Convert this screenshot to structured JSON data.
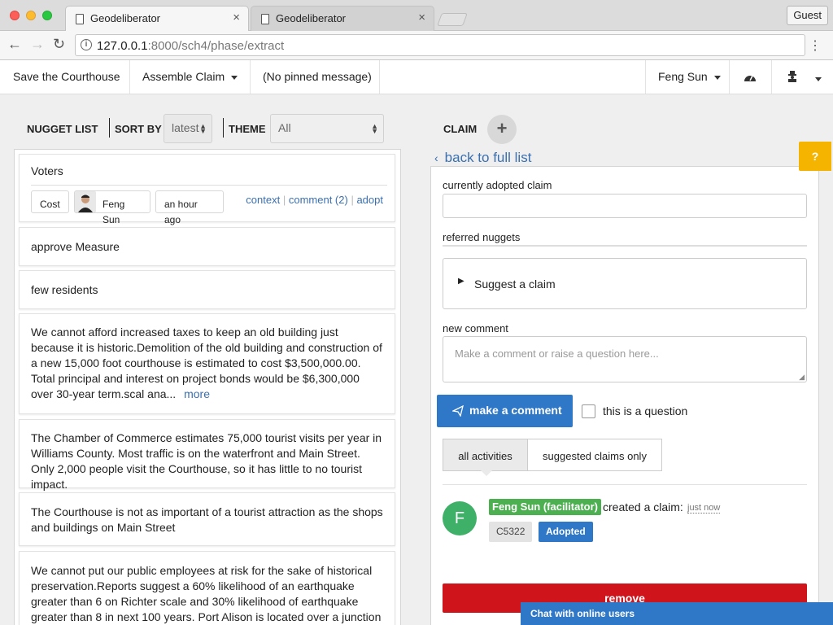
{
  "browser": {
    "tabs": [
      {
        "title": "Geodeliberator",
        "close": "×"
      },
      {
        "title": "Geodeliberator",
        "close": "×"
      }
    ],
    "guest_label": "Guest",
    "url_host": "127.0.0.1",
    "url_path": ":8000/sch4/phase/extract",
    "info_glyph": "i"
  },
  "navbar": {
    "project": "Save the Courthouse",
    "assemble": "Assemble Claim",
    "pinned": "(No pinned message)",
    "user": "Feng Sun"
  },
  "left": {
    "nugget_list": "NUGGET LIST",
    "sort_by": "SORT BY",
    "sort_value": "latest",
    "theme": "THEME",
    "theme_value": "All",
    "nuggets": [
      {
        "title": "Voters",
        "tag": "Cost",
        "author": "Feng Sun",
        "time": "an hour ago",
        "context": "context",
        "comment": "comment (2)",
        "adopt": "adopt"
      },
      {
        "text": "approve Measure"
      },
      {
        "text": "few residents"
      },
      {
        "text": "We cannot afford increased taxes to keep an old building just because it is historic.Demolition of the old building and construction of a new 15,000 foot courthouse is estimated to cost $3,500,000.00. Total principal and interest on project bonds would be $6,300,000 over 30-year term.scal ana...",
        "more": "more"
      },
      {
        "text": "The Chamber of Commerce estimates 75,000 tourist visits per year in Williams County. Most traffic is on the waterfront and Main Street. Only 2,000 people visit the Courthouse, so it has little to no tourist impact."
      },
      {
        "text": "The Courthouse is not as important of a tourist attraction as the shops and buildings on Main Street"
      },
      {
        "text": "We cannot put our public employees at risk for the sake of historical preservation.Reports suggest a 60% likelihood of an earthquake greater than 6 on Richter scale and 30% likelihood of earthquake greater than 8 in next 100 years. Port Alison is located over a junction of two plates"
      }
    ]
  },
  "right": {
    "claim": "CLAIM",
    "plus": "+",
    "back": "back to full list",
    "help": "?",
    "adopted_label": "currently adopted claim",
    "referred_label": "referred nuggets",
    "suggest": "Suggest a claim",
    "new_comment_label": "new comment",
    "comment_placeholder": "Make a comment or raise a question here...",
    "make_comment": "make a comment",
    "is_question": "this is a question",
    "tab_all": "all activities",
    "tab_suggested": "suggested claims only",
    "activity": {
      "avatar_letter": "F",
      "name": "Feng Sun (facilitator)",
      "action": "created a claim:",
      "time": "just now",
      "claim_id": "C5322",
      "status": "Adopted"
    },
    "remove": "remove",
    "chat": "Chat with online users"
  }
}
